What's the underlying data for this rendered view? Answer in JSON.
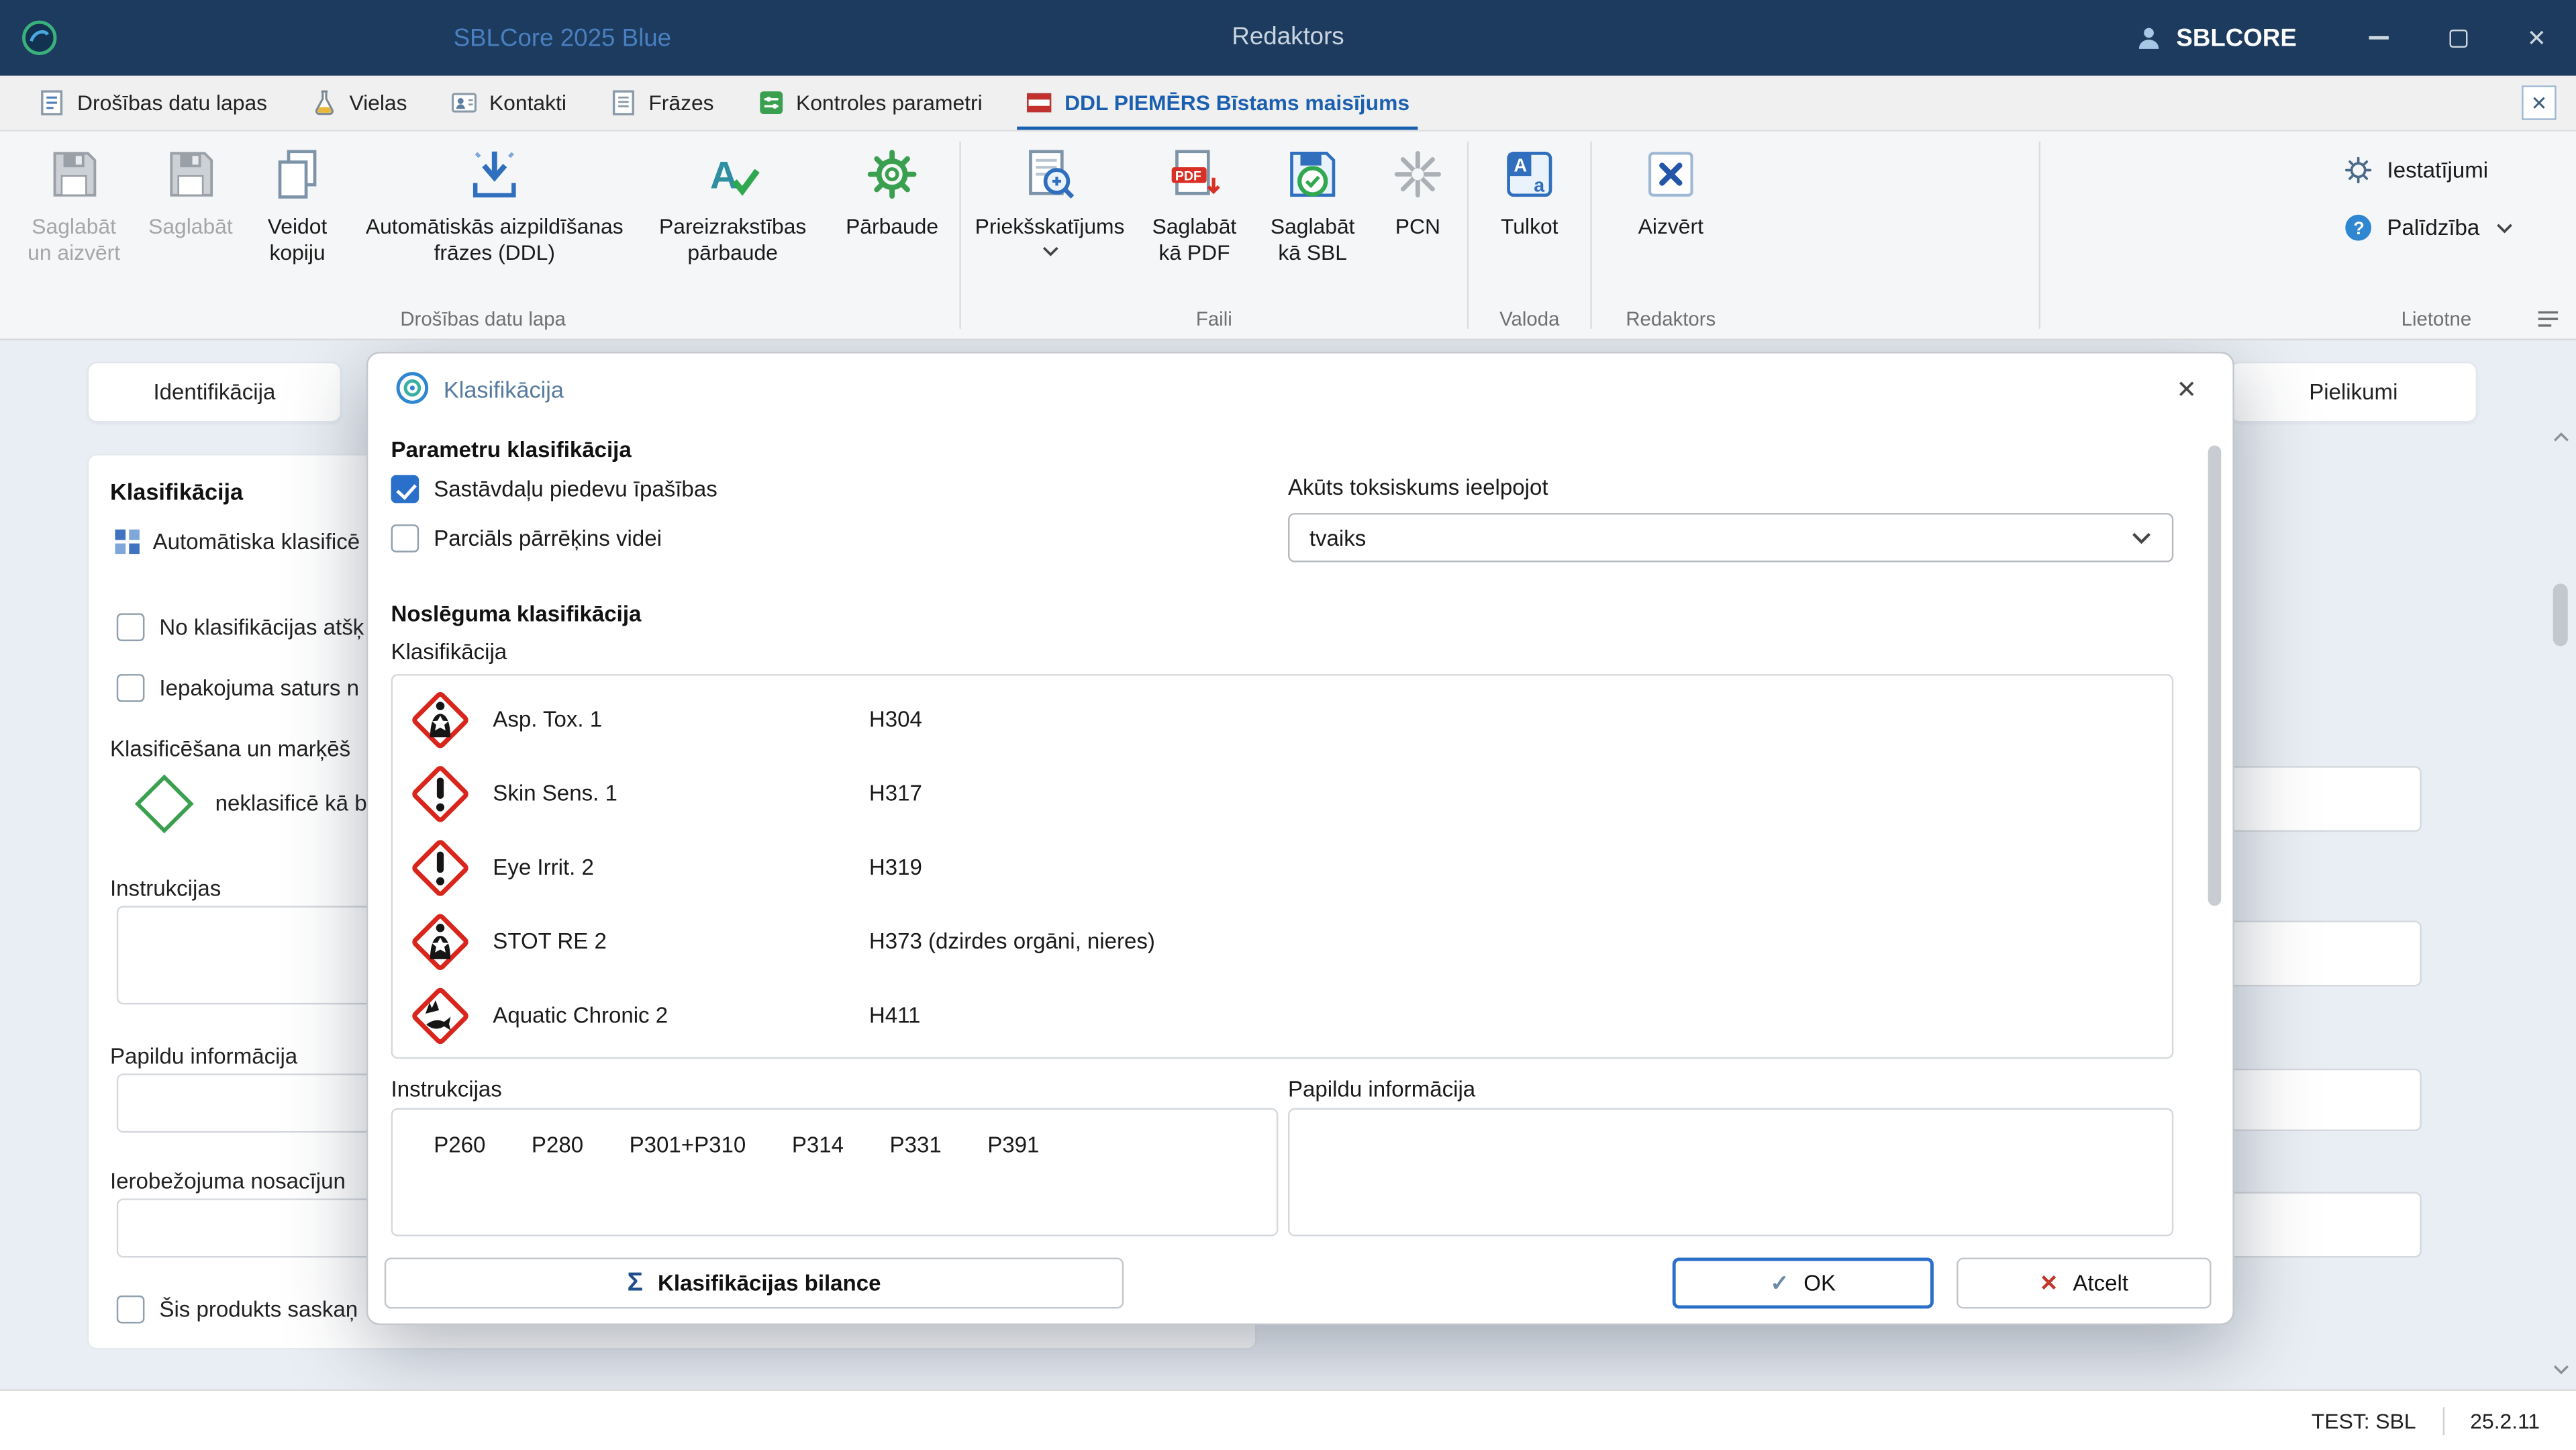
{
  "titlebar": {
    "app_title": "SBLCore 2025 Blue",
    "window_title": "Redaktors",
    "user_label": "SBLCORE"
  },
  "nav_tabs": {
    "items": [
      {
        "label": "Drošības datu lapas"
      },
      {
        "label": "Vielas"
      },
      {
        "label": "Kontakti"
      },
      {
        "label": "Frāzes"
      },
      {
        "label": "Kontroles parametri"
      },
      {
        "label": "DDL PIEMĒRS Bīstams maisījums"
      }
    ]
  },
  "ribbon": {
    "buttons": {
      "save_close": "Saglabāt un aizvērt",
      "save": "Saglabāt",
      "copy": "Veidot kopiju",
      "autofill": "Automātiskās aizpildīšanas frāzes (DDL)",
      "spellcheck": "Pareizrakstības pārbaude",
      "check": "Pārbaude",
      "preview": "Priekšskatījums",
      "save_pdf": "Saglabāt kā PDF",
      "save_sbl": "Saglabāt kā SBL",
      "pcn": "PCN",
      "translate": "Tulkot",
      "close_editor": "Aizvērt",
      "settings": "Iestatījumi",
      "help": "Palīdzība"
    },
    "groups": {
      "sds": "Drošības datu lapa",
      "files": "Faili",
      "language": "Valoda",
      "editor": "Redaktors",
      "app": "Lietotne"
    }
  },
  "page": {
    "tab_left": "Identifikācija",
    "tab_right": "Pielikumi",
    "panel_title": "Klasifikācija",
    "auto_classify": "Automātiska klasificē",
    "checkbox_diff": "No klasifikācijas atšķ",
    "checkbox_packaging": "Iepakojuma saturs n",
    "labeling_label": "Klasificēšana un marķēš",
    "unclassified": "neklasificē kā b",
    "instructions_label": "Instrukcijas",
    "additional_label": "Papildu informācija",
    "restriction_label": "Ierobežojuma nosacījun",
    "checkbox_product": "Šis produkts saskaņ"
  },
  "dialog": {
    "title": "Klasifikācija",
    "param_header": "Parametru klasifikācija",
    "checkbox_additive": {
      "label": "Sastāvdaļu piedevu īpašības",
      "checked": true
    },
    "checkbox_partial": {
      "label": "Parciāls pārrēķins videi",
      "checked": false
    },
    "acute_tox_label": "Akūts toksiskums ieelpojot",
    "acute_tox_value": "tvaiks",
    "final_header": "Noslēguma klasifikācija",
    "classification_label": "Klasifikācija",
    "classifications": [
      {
        "pictogram": "ghs08-health-hazard",
        "name": "Asp. Tox. 1",
        "code": "H304"
      },
      {
        "pictogram": "ghs07-exclamation",
        "name": "Skin Sens. 1",
        "code": "H317"
      },
      {
        "pictogram": "ghs07-exclamation",
        "name": "Eye Irrit. 2",
        "code": "H319"
      },
      {
        "pictogram": "ghs08-health-hazard",
        "name": "STOT RE 2",
        "code": "H373 (dzirdes orgāni, nieres)"
      },
      {
        "pictogram": "ghs09-environment",
        "name": "Aquatic Chronic 2",
        "code": "H411"
      }
    ],
    "instructions_label": "Instrukcijas",
    "p_codes": [
      "P260",
      "P280",
      "P301+P310",
      "P314",
      "P331",
      "P391"
    ],
    "additional_label": "Papildu informācija",
    "balance_button": "Klasifikācijas bilance",
    "ok_button": "OK",
    "cancel_button": "Atcelt"
  },
  "statusbar": {
    "test_label": "TEST: SBL",
    "version": "25.2.11"
  },
  "colors": {
    "titlebar_bg": "#1c3b5e",
    "accent_blue": "#2a6fc9",
    "ghs_red": "#d9261c",
    "green": "#3aa04f"
  }
}
